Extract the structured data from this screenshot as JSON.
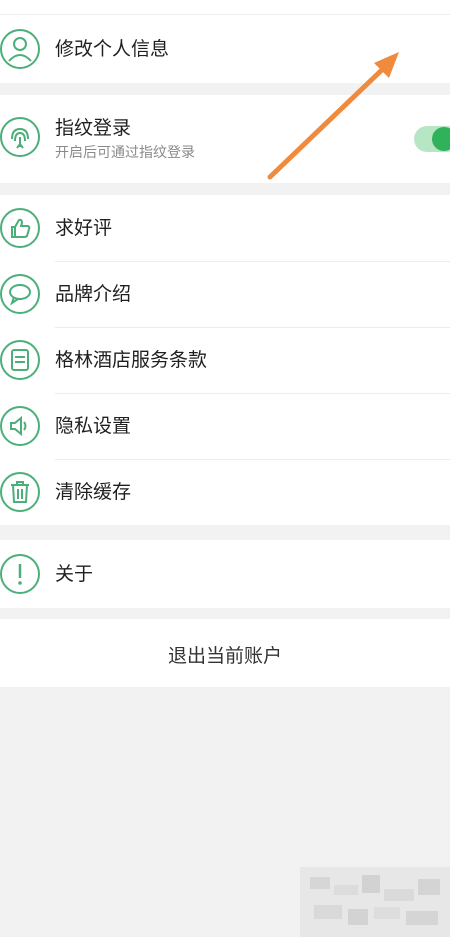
{
  "menu": {
    "edit_profile": "修改个人信息",
    "fingerprint": {
      "title": "指纹登录",
      "subtitle": "开启后可通过指纹登录",
      "enabled": true
    },
    "rate": "求好评",
    "brand": "品牌介绍",
    "terms": "格林酒店服务条款",
    "privacy": "隐私设置",
    "clear_cache": "清除缓存",
    "about": "关于"
  },
  "logout": "退出当前账户",
  "icons": {
    "edit_profile": "user-icon",
    "fingerprint": "fingerprint-icon",
    "rate": "thumbs-up-icon",
    "brand": "chat-bubble-icon",
    "terms": "document-icon",
    "privacy": "speaker-icon",
    "clear_cache": "trash-icon",
    "about": "exclamation-icon"
  },
  "colors": {
    "icon_green": "#4caf7a",
    "toggle_on": "#2fb25a",
    "annotation_arrow": "#f08a3c"
  }
}
